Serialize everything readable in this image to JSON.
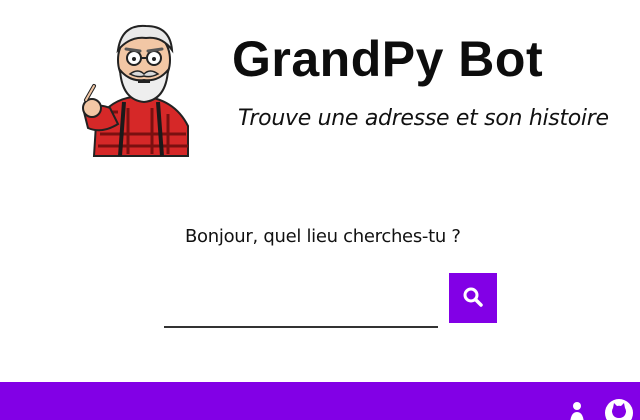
{
  "app": {
    "title": "GrandPy Bot",
    "subtitle": "Trouve une adresse et son histoire"
  },
  "chat": {
    "prompt": "Bonjour, quel lieu cherches-tu ?"
  },
  "search": {
    "value": "",
    "placeholder": "",
    "button_icon": "search-icon"
  },
  "footer": {
    "icons": [
      "person-icon",
      "github-icon"
    ]
  },
  "colors": {
    "accent": "#8200e6",
    "shirt_red": "#d62828",
    "text": "#111111"
  }
}
